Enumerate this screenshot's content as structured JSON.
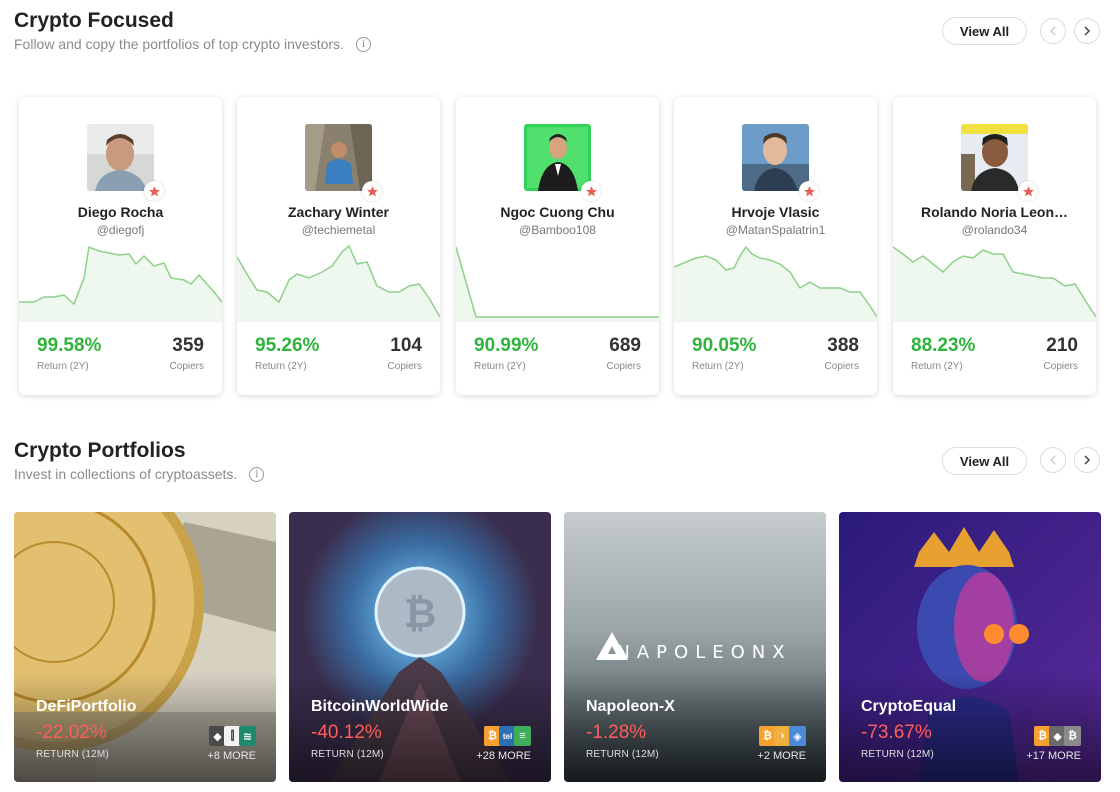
{
  "crypto_focused": {
    "title": "Crypto Focused",
    "subtitle": "Follow and copy the portfolios of top crypto investors.",
    "view_all": "View All",
    "investors": [
      {
        "name": "Diego Rocha",
        "handle": "@diegofj",
        "return": "99.58%",
        "return_label": "Return (2Y)",
        "copiers": "359",
        "copiers_label": "Copiers"
      },
      {
        "name": "Zachary Winter",
        "handle": "@techiemetal",
        "return": "95.26%",
        "return_label": "Return (2Y)",
        "copiers": "104",
        "copiers_label": "Copiers"
      },
      {
        "name": "Ngoc Cuong Chu",
        "handle": "@Bamboo108",
        "return": "90.99%",
        "return_label": "Return (2Y)",
        "copiers": "689",
        "copiers_label": "Copiers"
      },
      {
        "name": "Hrvoje Vlasic",
        "handle": "@MatanSpalatrin1",
        "return": "90.05%",
        "return_label": "Return (2Y)",
        "copiers": "388",
        "copiers_label": "Copiers"
      },
      {
        "name": "Rolando Noria Leon…",
        "handle": "@rolando34",
        "return": "88.23%",
        "return_label": "Return (2Y)",
        "copiers": "210",
        "copiers_label": "Copiers"
      }
    ]
  },
  "crypto_portfolios": {
    "title": "Crypto Portfolios",
    "subtitle": "Invest in collections of cryptoassets.",
    "view_all": "View All",
    "portfolios": [
      {
        "name": "DeFiPortfolio",
        "return": "-22.02%",
        "return_label": "RETURN (12M)",
        "more": "+8 MORE"
      },
      {
        "name": "BitcoinWorldWide",
        "return": "-40.12%",
        "return_label": "RETURN (12M)",
        "more": "+28 MORE"
      },
      {
        "name": "Napoleon-X",
        "return": "-1.28%",
        "return_label": "RETURN (12M)",
        "more": "+2 MORE",
        "logo_text": "NAPOLEONX"
      },
      {
        "name": "CryptoEqual",
        "return": "-73.67%",
        "return_label": "RETURN (12M)",
        "more": "+17 MORE"
      }
    ]
  },
  "colors": {
    "positive": "#2fb33c",
    "negative": "#ff5c5c",
    "star": "#e8605a"
  }
}
